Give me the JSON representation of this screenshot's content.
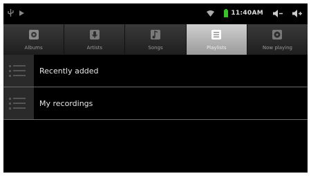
{
  "status_bar": {
    "time": "11:40AM",
    "icons": [
      "usb-icon",
      "sync-icon",
      "wifi-icon",
      "battery-icon",
      "volume-down-icon",
      "volume-up-icon"
    ]
  },
  "tabs": [
    {
      "label": "Albums",
      "icon": "album-icon",
      "selected": false
    },
    {
      "label": "Artists",
      "icon": "microphone-icon",
      "selected": false
    },
    {
      "label": "Songs",
      "icon": "music-note-icon",
      "selected": false
    },
    {
      "label": "Playlists",
      "icon": "playlist-icon",
      "selected": true
    },
    {
      "label": "Now playing",
      "icon": "now-playing-icon",
      "selected": false
    }
  ],
  "playlists": [
    {
      "label": "Recently added",
      "icon": "list-icon"
    },
    {
      "label": "My recordings",
      "icon": "list-icon"
    }
  ],
  "colors": {
    "background": "#000000",
    "tab_selected": "#b5b5b5",
    "battery": "#39c52a"
  }
}
